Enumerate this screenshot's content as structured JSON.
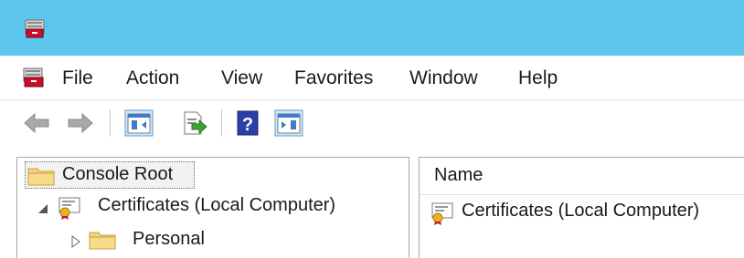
{
  "window": {
    "icon": "certificate-manager-icon",
    "accent": "#5cc6ee"
  },
  "menu": {
    "items": [
      "File",
      "Action",
      "View",
      "Favorites",
      "Window",
      "Help"
    ]
  },
  "toolbar": {
    "icons": [
      "back-arrow-icon",
      "forward-arrow-icon",
      "show-hide-console-tree-icon",
      "export-list-icon",
      "help-icon",
      "show-hide-action-pane-icon"
    ]
  },
  "tree": {
    "root": "Console Root",
    "items": [
      {
        "label": "Certificates (Local Computer)",
        "expanded": true
      },
      {
        "label": "Personal",
        "expanded": false
      }
    ]
  },
  "list": {
    "column_name": "Name",
    "rows": [
      "Certificates (Local Computer)"
    ]
  }
}
